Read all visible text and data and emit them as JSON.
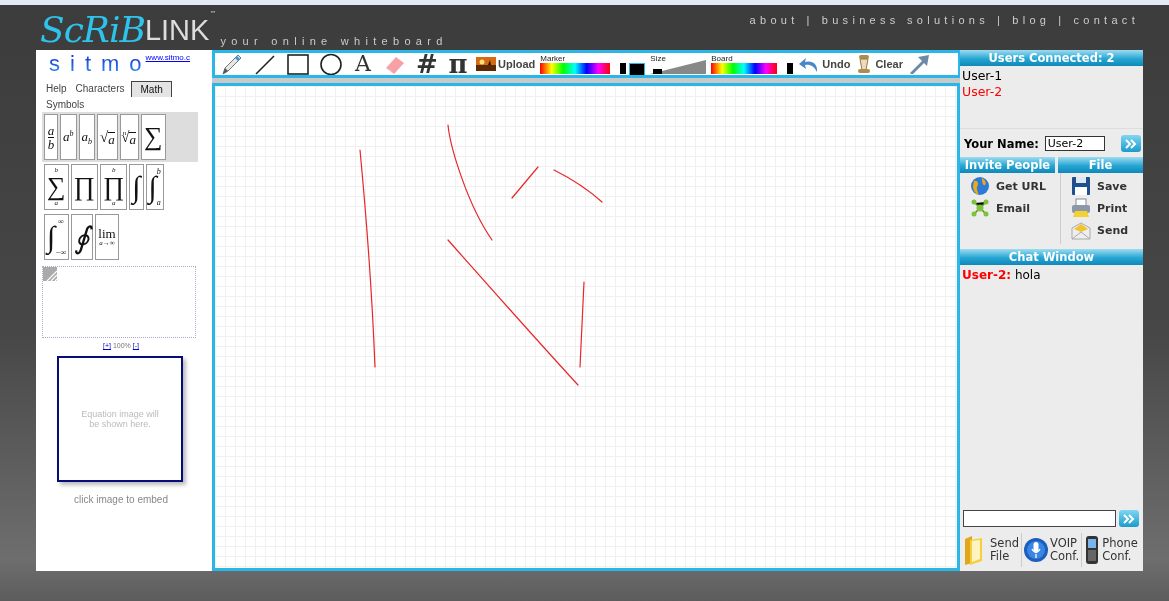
{
  "header": {
    "logo": {
      "script": "ScRiB",
      "plain": "LINK",
      "mark": "™"
    },
    "tagline": "your online whiteboard",
    "nav": [
      {
        "label": "about"
      },
      {
        "separator": "|",
        "label": "business solutions"
      },
      {
        "separator": "|",
        "label": "blog"
      },
      {
        "separator": "|",
        "label": "contact"
      }
    ]
  },
  "left_panel": {
    "sitmo": {
      "letters": [
        "s",
        "i",
        "t",
        "m",
        "o"
      ],
      "link": "www.sitmo.c"
    },
    "tabs": [
      {
        "label": "Help",
        "selected": false
      },
      {
        "label": "Characters",
        "selected": false
      },
      {
        "label": "Math",
        "selected": true
      },
      {
        "label": "Symbols",
        "selected": false
      }
    ],
    "symbol_rows": [
      {
        "highlighted": true,
        "symbols": [
          {
            "kind": "frac",
            "top": "a",
            "bottom": "b"
          },
          {
            "kind": "sup",
            "base": "a",
            "sup": "b"
          },
          {
            "kind": "sub",
            "base": "a",
            "sub": "b"
          },
          {
            "kind": "root",
            "sign": "√",
            "body": "a"
          },
          {
            "kind": "root",
            "index": "n",
            "sign": "√",
            "body": "a"
          },
          {
            "kind": "op",
            "op": "∑"
          }
        ]
      },
      {
        "highlighted": false,
        "symbols": [
          {
            "kind": "op",
            "op": "∑",
            "upper": "b",
            "lower": "a"
          },
          {
            "kind": "op",
            "op": "∏"
          },
          {
            "kind": "op",
            "op": "∏",
            "upper": "b",
            "lower": "a"
          },
          {
            "kind": "int",
            "op": "∫"
          },
          {
            "kind": "int",
            "op": "∫",
            "upper": "b",
            "lower": "a"
          }
        ]
      },
      {
        "highlighted": false,
        "symbols": [
          {
            "kind": "int",
            "op": "∫",
            "upper": "∞",
            "lower": "−∞"
          },
          {
            "kind": "int",
            "op": "∮"
          },
          {
            "kind": "op",
            "op": "lim",
            "lower": "a→∞"
          }
        ]
      }
    ],
    "zoom": {
      "plus": "[+]",
      "percent": "100%",
      "minus": "[-]"
    },
    "preview": {
      "placeholder": "Equation image will be shown here.",
      "caption": "click image to embed"
    }
  },
  "toolbar": {
    "tools": [
      {
        "kind": "pencil"
      },
      {
        "kind": "line"
      },
      {
        "kind": "rect"
      },
      {
        "kind": "circle"
      },
      {
        "kind": "glyph",
        "text": "A"
      },
      {
        "kind": "eraser"
      },
      {
        "kind": "glyph",
        "text": "#"
      },
      {
        "kind": "glyph",
        "text": "π"
      }
    ],
    "upload": "Upload",
    "marker": {
      "label": "Marker",
      "color": "#000000"
    },
    "size": {
      "label": "Size",
      "level": 0.05
    },
    "board": {
      "label": "Board"
    },
    "undo": "Undo",
    "clear": "Clear"
  },
  "right_panel": {
    "users": {
      "title": "Users Connected: 2",
      "list": [
        {
          "name": "User-1",
          "color": "#000000"
        },
        {
          "name": "User-2",
          "color": "#ff0000"
        }
      ]
    },
    "name_field": {
      "label": "Your Name:",
      "value": "User-2"
    },
    "invite": {
      "title": "Invite People",
      "items": [
        {
          "label": "Get URL",
          "kind": "globe"
        },
        {
          "label": "Email",
          "kind": "network"
        }
      ]
    },
    "file": {
      "title": "File",
      "items": [
        {
          "label": "Save",
          "kind": "floppy"
        },
        {
          "label": "Print",
          "kind": "printer"
        },
        {
          "label": "Send",
          "kind": "envelope"
        }
      ]
    },
    "chat": {
      "title": "Chat Window",
      "messages": [
        {
          "user": "User-2:",
          "text": "hola",
          "color": "#ff0000"
        }
      ]
    },
    "actions": [
      {
        "lines": [
          "Send",
          "File"
        ],
        "kind": "folder"
      },
      {
        "lines": [
          "VOIP",
          "Conf."
        ],
        "kind": "microphone"
      },
      {
        "lines": [
          "Phone",
          "Conf."
        ],
        "kind": "phone"
      }
    ]
  }
}
